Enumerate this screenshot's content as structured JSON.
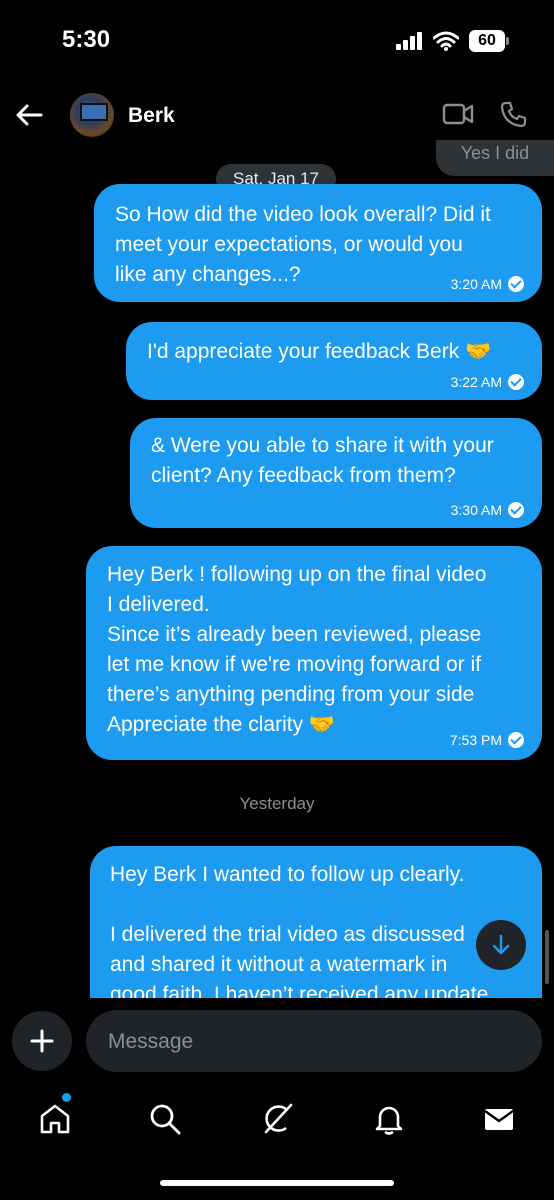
{
  "status": {
    "time": "5:30",
    "battery": "60"
  },
  "header": {
    "contact_name": "Berk"
  },
  "chat": {
    "prev_received_text": "Yes I did",
    "date_pill": "Sat, Jan 17",
    "messages": [
      {
        "text": "So How did the video look overall? Did it\nmeet your expectations, or would you\nlike any changes...?",
        "time": "3:20 AM"
      },
      {
        "text": "I'd appreciate your feedback Berk 🤝",
        "time": "3:22 AM"
      },
      {
        "text": "& Were you able to share it with your\nclient?  Any feedback from them?",
        "time": "3:30 AM"
      },
      {
        "text": "Hey Berk !  following up on the final video\nI delivered.\nSince it’s already been reviewed, please\nlet me know if we're moving forward or if\nthere’s anything pending from your side\nAppreciate the clarity 🤝",
        "time": "7:53 PM"
      }
    ],
    "day_label": "Yesterday",
    "last_message_text": "Hey Berk I wanted to follow up clearly.\n\nI delivered the trial video as discussed\nand shared it without a watermark in\ngood faith. I haven’t received any update"
  },
  "composer": {
    "placeholder": "Message"
  },
  "colors": {
    "bubble_blue": "#1d9bf0",
    "background": "#000000",
    "surface": "#202327"
  },
  "icons": [
    "back-arrow-icon",
    "video-call-icon",
    "phone-icon",
    "plus-icon",
    "scroll-down-icon",
    "home-icon",
    "search-icon",
    "grok-icon",
    "bell-icon",
    "mail-icon"
  ]
}
